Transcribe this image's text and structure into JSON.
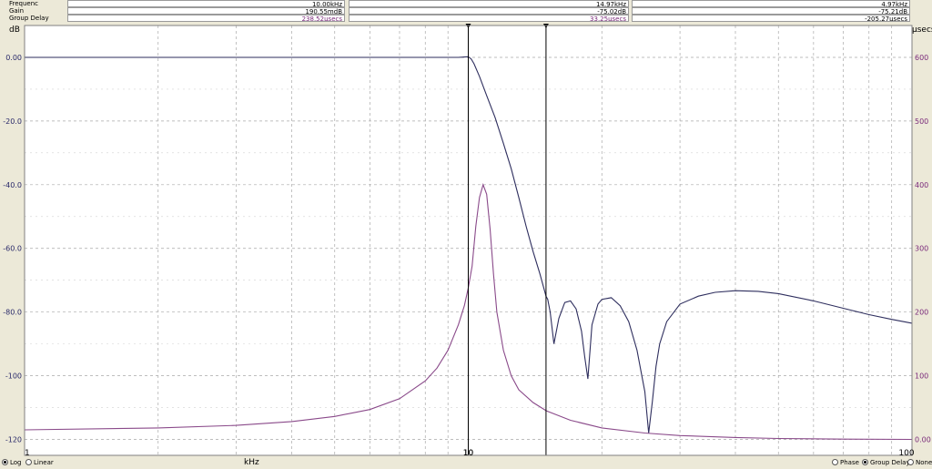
{
  "readout": {
    "rows": [
      {
        "label": "Frequenc",
        "v1": "10.00kHz",
        "v2": "14.97kHz",
        "v3": "4.97kHz"
      },
      {
        "label": "Gain",
        "v1": "190.55mdB",
        "v2": "-75.02dB",
        "v3": "-75.21dB"
      },
      {
        "label": "Group Delay",
        "v1": "238.52µsecs",
        "v2": "33.25µsecs",
        "v3": "-205.27µsecs"
      }
    ]
  },
  "bottom": {
    "log": "Log",
    "linear": "Linear",
    "phase": "Phase",
    "group_delay": "Group Delay",
    "none": "None",
    "scale_selected": "Log",
    "display_selected": "Group Delay"
  },
  "colors": {
    "gain_trace": "#2e2e5e",
    "delay_trace": "#8a4a8a",
    "cursor": "#000000",
    "grid": "#a8a8a8"
  },
  "chart_data": {
    "type": "line",
    "xlabel": "kHz",
    "x_scale": "log",
    "xlim": [
      1,
      100
    ],
    "x_ticks": [
      "1",
      "10",
      "100"
    ],
    "y_left_label": "dB",
    "ylim_left": [
      -125,
      10
    ],
    "y_left_ticks": [
      "0.00",
      "-20.0",
      "-40.0",
      "-60.0",
      "-80.0",
      "-100",
      "-120"
    ],
    "y_right_label": "µsecs",
    "ylim_right": [
      -25,
      650
    ],
    "y_right_ticks": [
      "600",
      "500",
      "400",
      "300",
      "200",
      "100",
      "0.00"
    ],
    "grid": true,
    "cursors": [
      {
        "label": "10",
        "x": 10
      },
      {
        "label": "",
        "x": 14.97
      }
    ],
    "series": [
      {
        "axis": "left",
        "x": [
          1,
          2,
          4,
          6,
          8,
          9,
          9.5,
          9.8,
          10,
          10.15,
          10.3,
          10.6,
          11,
          11.5,
          12,
          12.5,
          13,
          13.5,
          14,
          14.5,
          14.97,
          15.1,
          15.3,
          15.6,
          16,
          16.5,
          17,
          17.5,
          18,
          18.3,
          18.6,
          19,
          19.6,
          20,
          21,
          22,
          23,
          24,
          25,
          25.5,
          26,
          26.5,
          27,
          28,
          30,
          33,
          36,
          40,
          45,
          50,
          60,
          70,
          80,
          90,
          100
        ],
        "values": [
          0,
          0,
          0,
          0,
          0,
          0,
          0,
          0.1,
          0.19,
          -0.5,
          -2,
          -6,
          -12,
          -19,
          -27,
          -35,
          -44,
          -53,
          -61,
          -68,
          -75,
          -76,
          -80,
          -90,
          -82,
          -77,
          -76.5,
          -79,
          -86,
          -94,
          -101,
          -84,
          -77.5,
          -76,
          -75.5,
          -78,
          -83,
          -92,
          -105,
          -118,
          -108,
          -97,
          -90,
          -83,
          -77.5,
          -75,
          -73.8,
          -73.3,
          -73.5,
          -74.2,
          -76.5,
          -78.8,
          -80.8,
          -82.3,
          -83.5
        ]
      },
      {
        "axis": "right",
        "x": [
          1,
          2,
          3,
          4,
          5,
          6,
          7,
          8,
          8.5,
          9,
          9.5,
          9.8,
          10,
          10.2,
          10.4,
          10.6,
          10.8,
          11,
          11.2,
          11.4,
          11.6,
          12,
          12.5,
          13,
          14,
          15,
          17,
          20,
          25,
          30,
          40,
          50,
          70,
          100
        ],
        "values": [
          15,
          18,
          22,
          28,
          36,
          47,
          64,
          92,
          112,
          140,
          180,
          210,
          238,
          272,
          335,
          380,
          400,
          385,
          330,
          260,
          200,
          140,
          100,
          78,
          58,
          45,
          30,
          18,
          10,
          6,
          3,
          1.5,
          0.5,
          0
        ]
      }
    ]
  }
}
